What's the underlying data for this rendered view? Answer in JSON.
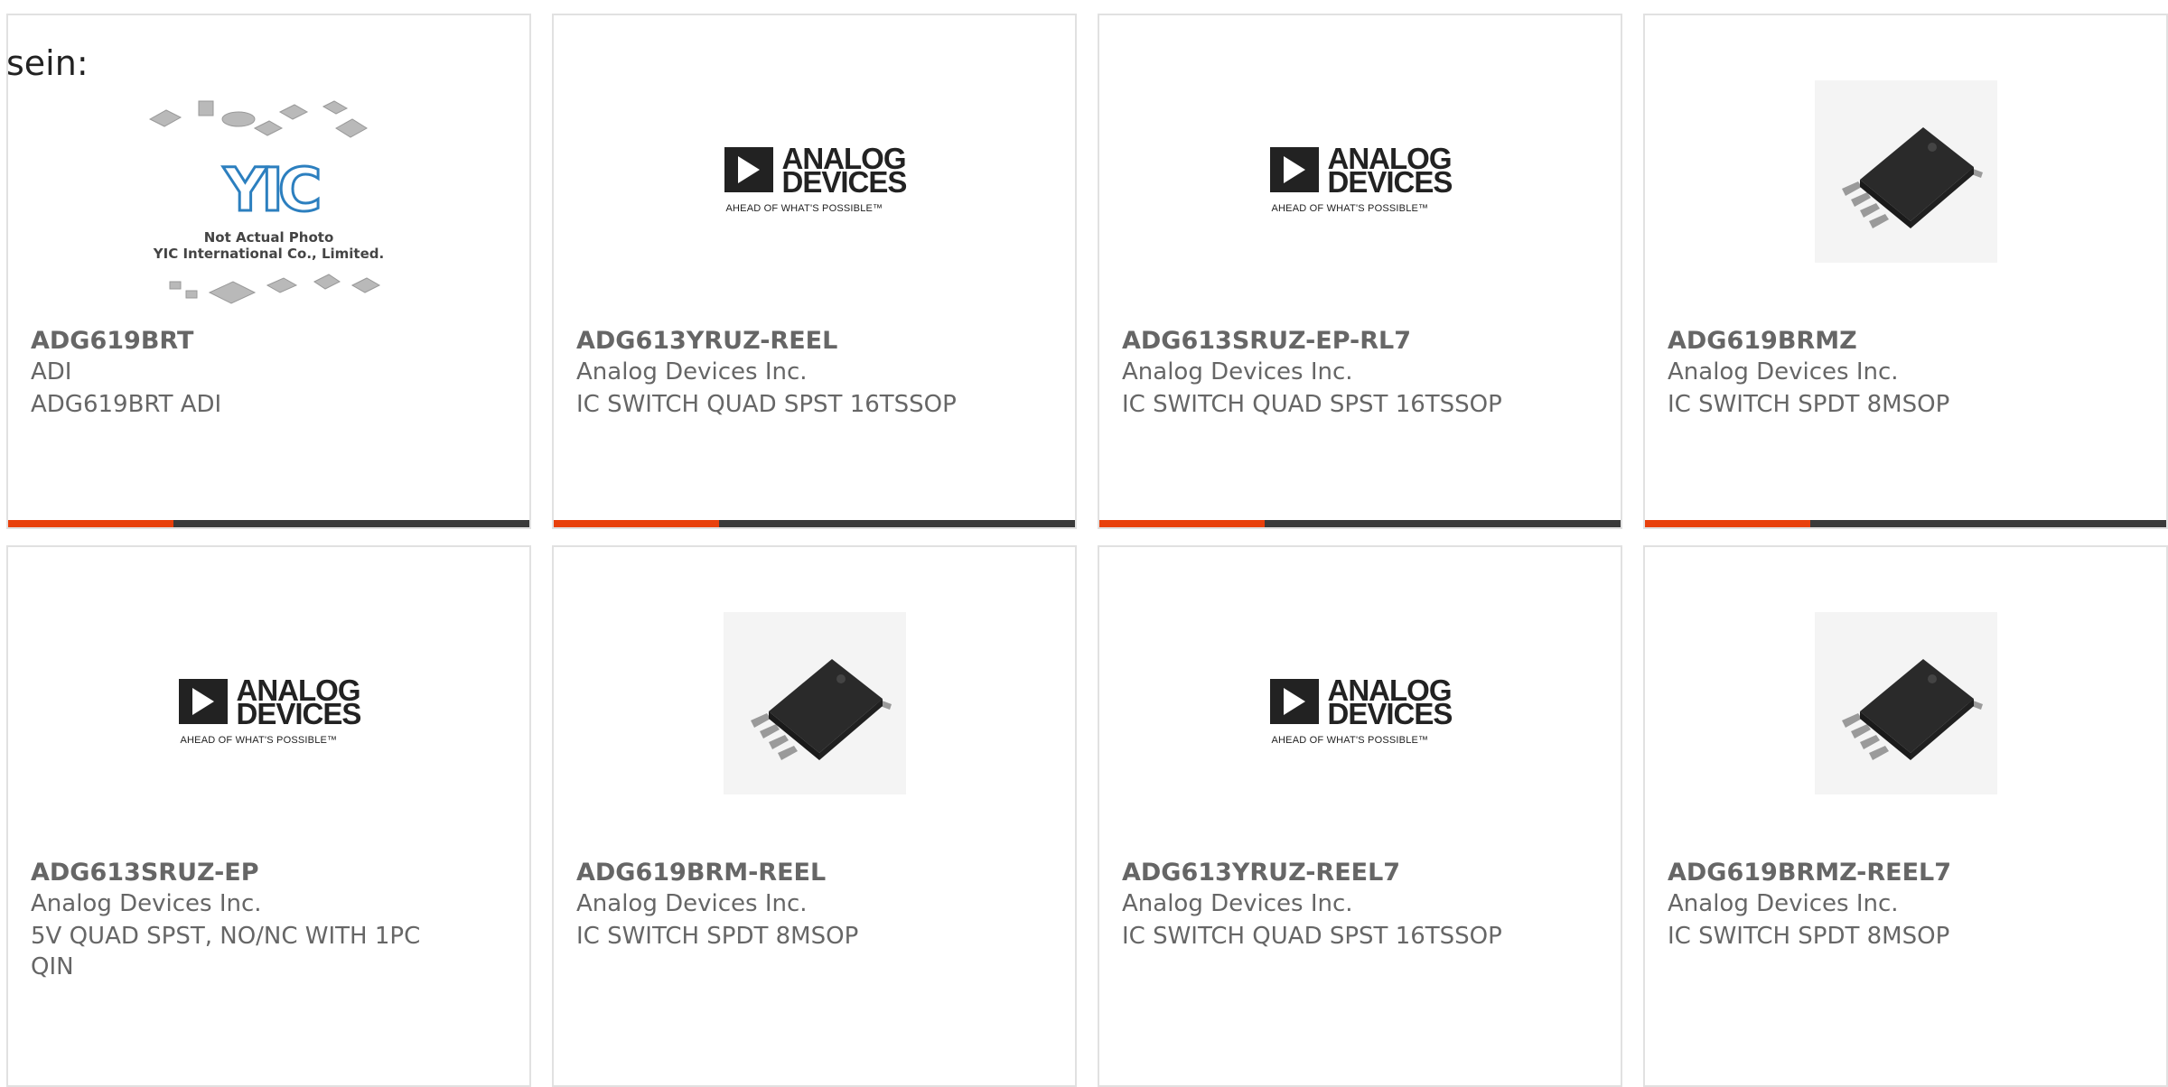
{
  "page_label": "sein:",
  "products": [
    {
      "part": "ADG619BRT",
      "manufacturer": "ADI",
      "description": "ADG619BRT ADI",
      "image": "yic-placeholder",
      "placeholder_text": {
        "line1": "Not Actual Photo",
        "line2": "YIC International Co., Limited.",
        "logo": "YIC"
      }
    },
    {
      "part": "ADG613YRUZ-REEL",
      "manufacturer": "Analog Devices Inc.",
      "description": "IC SWITCH QUAD SPST 16TSSOP",
      "image": "analog-devices-logo"
    },
    {
      "part": "ADG613SRUZ-EP-RL7",
      "manufacturer": "Analog Devices Inc.",
      "description": "IC SWITCH QUAD SPST 16TSSOP",
      "image": "analog-devices-logo"
    },
    {
      "part": "ADG619BRMZ",
      "manufacturer": "Analog Devices Inc.",
      "description": "IC SWITCH SPDT 8MSOP",
      "image": "msop8-chip-photo"
    },
    {
      "part": "ADG613SRUZ-EP",
      "manufacturer": "Analog Devices Inc.",
      "description": "5V QUAD SPST, NO/NC WITH 1PC QIN",
      "image": "analog-devices-logo"
    },
    {
      "part": "ADG619BRM-REEL",
      "manufacturer": "Analog Devices Inc.",
      "description": "IC SWITCH SPDT 8MSOP",
      "image": "msop8-chip-photo"
    },
    {
      "part": "ADG613YRUZ-REEL7",
      "manufacturer": "Analog Devices Inc.",
      "description": "IC SWITCH QUAD SPST 16TSSOP",
      "image": "analog-devices-logo"
    },
    {
      "part": "ADG619BRMZ-REEL7",
      "manufacturer": "Analog Devices Inc.",
      "description": "IC SWITCH SPDT 8MSOP",
      "image": "msop8-chip-photo"
    }
  ],
  "logo": {
    "line1": "ANALOG",
    "line2": "DEVICES",
    "tagline": "AHEAD OF WHAT'S POSSIBLE™"
  },
  "colors": {
    "accent": "#e8400c",
    "bar": "#3a3a3a",
    "border": "#e1e1e1",
    "text": "#666666"
  }
}
